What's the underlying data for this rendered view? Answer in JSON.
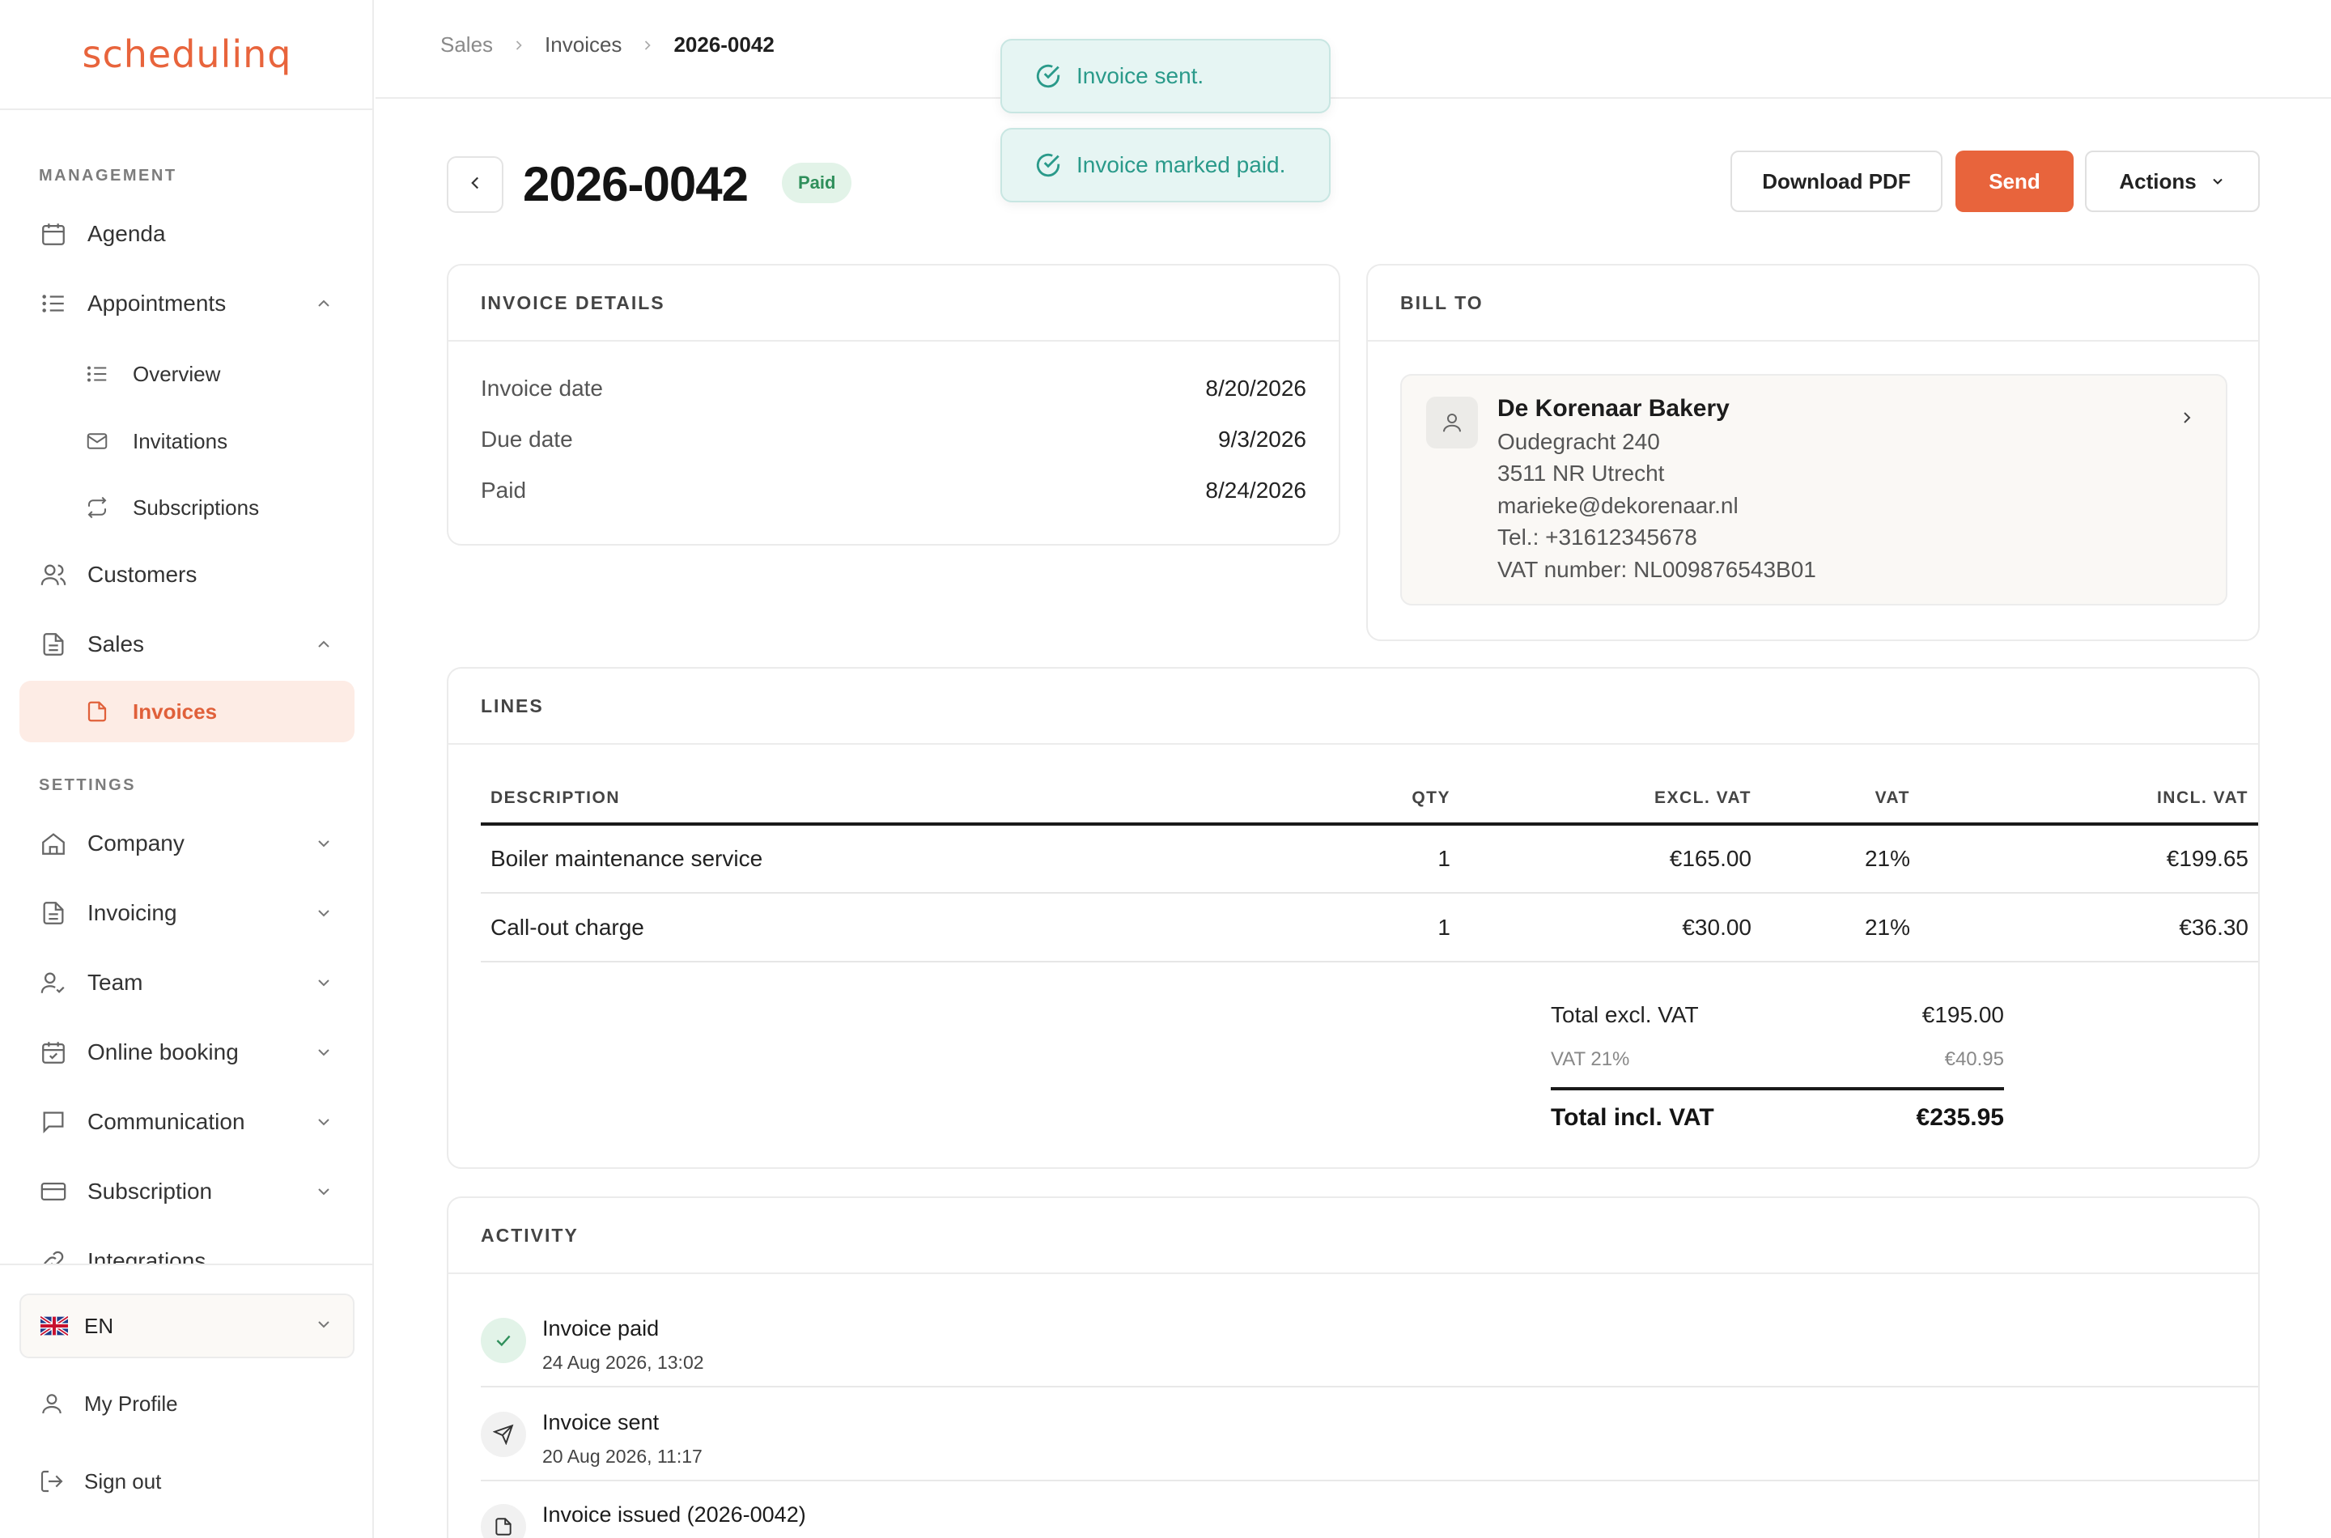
{
  "app": {
    "logo_text": "schedulinq",
    "accent_color": "#e8643c"
  },
  "sidebar": {
    "section_management": "MANAGEMENT",
    "section_settings": "SETTINGS",
    "items": {
      "agenda": "Agenda",
      "appointments": "Appointments",
      "overview": "Overview",
      "invitations": "Invitations",
      "subscriptions": "Subscriptions",
      "customers": "Customers",
      "sales": "Sales",
      "invoices": "Invoices",
      "company": "Company",
      "invoicing": "Invoicing",
      "team": "Team",
      "online_booking": "Online booking",
      "communication": "Communication",
      "subscription": "Subscription",
      "integrations": "Integrations"
    },
    "language": "EN",
    "my_profile": "My Profile",
    "sign_out": "Sign out"
  },
  "breadcrumb": {
    "level1": "Sales",
    "level2": "Invoices",
    "current": "2026-0042"
  },
  "toasts": {
    "sent": "Invoice sent.",
    "paid": "Invoice marked paid."
  },
  "header": {
    "title": "2026-0042",
    "status": "Paid",
    "download_label": "Download PDF",
    "send_label": "Send",
    "actions_label": "Actions"
  },
  "invoice_details": {
    "heading": "INVOICE DETAILS",
    "rows": [
      {
        "label": "Invoice date",
        "value": "8/20/2026"
      },
      {
        "label": "Due date",
        "value": "9/3/2026"
      },
      {
        "label": "Paid",
        "value": "8/24/2026"
      }
    ]
  },
  "bill_to": {
    "heading": "BILL TO",
    "name": "De Korenaar Bakery",
    "address1": "Oudegracht 240",
    "address2": "3511 NR Utrecht",
    "email": "marieke@dekorenaar.nl",
    "phone": "Tel.: +31612345678",
    "vat": "VAT number: NL009876543B01"
  },
  "lines": {
    "heading": "LINES",
    "columns": {
      "description": "DESCRIPTION",
      "qty": "QTY",
      "excl": "EXCL. VAT",
      "vat": "VAT",
      "incl": "INCL. VAT"
    },
    "rows": [
      {
        "description": "Boiler maintenance service",
        "qty": "1",
        "excl": "€165.00",
        "vat": "21%",
        "incl": "€199.65"
      },
      {
        "description": "Call-out charge",
        "qty": "1",
        "excl": "€30.00",
        "vat": "21%",
        "incl": "€36.30"
      }
    ],
    "totals": {
      "excl_label": "Total excl. VAT",
      "excl_value": "€195.00",
      "vat_label": "VAT 21%",
      "vat_value": "€40.95",
      "incl_label": "Total incl. VAT",
      "incl_value": "€235.95"
    }
  },
  "activity": {
    "heading": "ACTIVITY",
    "items": [
      {
        "title": "Invoice paid",
        "time": "24 Aug 2026, 13:02"
      },
      {
        "title": "Invoice sent",
        "time": "20 Aug 2026, 11:17"
      },
      {
        "title": "Invoice issued (2026-0042)",
        "time": ""
      }
    ]
  }
}
